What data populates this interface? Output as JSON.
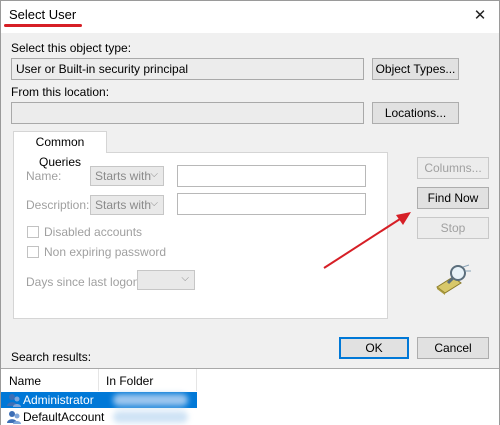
{
  "dialog": {
    "title": "Select User",
    "close_glyph": "✕"
  },
  "object_type": {
    "label": "Select this object type:",
    "value": "User or Built-in security principal",
    "button": "Object Types..."
  },
  "location": {
    "label": "From this location:",
    "value": "",
    "button": "Locations..."
  },
  "queries": {
    "tab_label": "Common Queries",
    "name_label": "Name:",
    "name_mode": "Starts with",
    "name_value": "",
    "description_label": "Description:",
    "description_mode": "Starts with",
    "description_value": "",
    "disabled_accounts": "Disabled accounts",
    "non_expiring": "Non expiring password",
    "days_label": "Days since last logon:",
    "days_value": ""
  },
  "side_buttons": {
    "columns": "Columns...",
    "find_now": "Find Now",
    "stop": "Stop"
  },
  "footer": {
    "ok": "OK",
    "cancel": "Cancel"
  },
  "results": {
    "label": "Search results:",
    "columns": [
      "Name",
      "In Folder"
    ],
    "rows": [
      {
        "name": "Administrator",
        "folder": "",
        "selected": true
      },
      {
        "name": "DefaultAccount",
        "folder": "",
        "selected": false
      }
    ]
  },
  "colors": {
    "accent": "#0078d7",
    "annotation_red": "#d61f26"
  },
  "icons": [
    "close-icon",
    "search-flashlight-icon",
    "user-icon",
    "dropdown-arrow-icon"
  ]
}
